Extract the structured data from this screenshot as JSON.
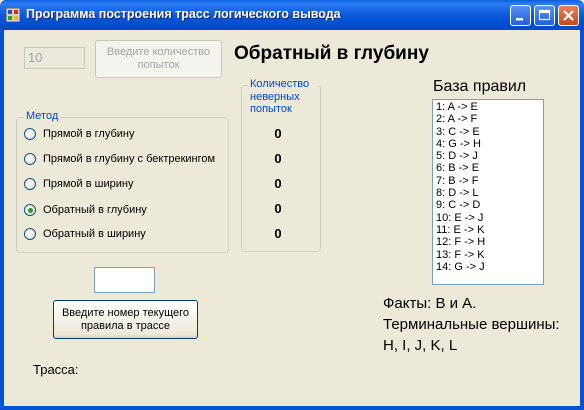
{
  "window": {
    "title": "Программа построения трасс логического вывода"
  },
  "top": {
    "attempts_value": "10",
    "attempts_button": "Введите количество попыток",
    "current_method_title": "Обратный в глубину"
  },
  "methods": {
    "group_label": "Метод",
    "items": [
      {
        "label": "Прямой в глубину",
        "checked": false
      },
      {
        "label": "Прямой в глубину с бектрекингом",
        "checked": false
      },
      {
        "label": "Прямой в ширину",
        "checked": false
      },
      {
        "label": "Обратный в глубину",
        "checked": true
      },
      {
        "label": "Обратный в ширину",
        "checked": false
      }
    ]
  },
  "wrong_attempts": {
    "group_label": "Количество неверных попыток",
    "counts": [
      "0",
      "0",
      "0",
      "0",
      "0"
    ]
  },
  "rules": {
    "label": "База правил",
    "items": [
      "1: A -> E",
      "2: A -> F",
      "3: C -> E",
      "4: G -> H",
      "5: D -> J",
      "6: B -> E",
      "7: B -> F",
      "8: D -> L",
      "9: C -> D",
      "10: E -> J",
      "11: E -> K",
      "12: F -> H",
      "13: F -> K",
      "14: G -> J"
    ]
  },
  "rule_input": {
    "value": "",
    "button": "Введите номер текущего правила в трассе"
  },
  "facts": {
    "line1": "Факты: B и A.",
    "line2": "Терминальные вершины:",
    "line3": "H, I, J, K, L"
  },
  "trace": {
    "label": "Трасса:"
  }
}
